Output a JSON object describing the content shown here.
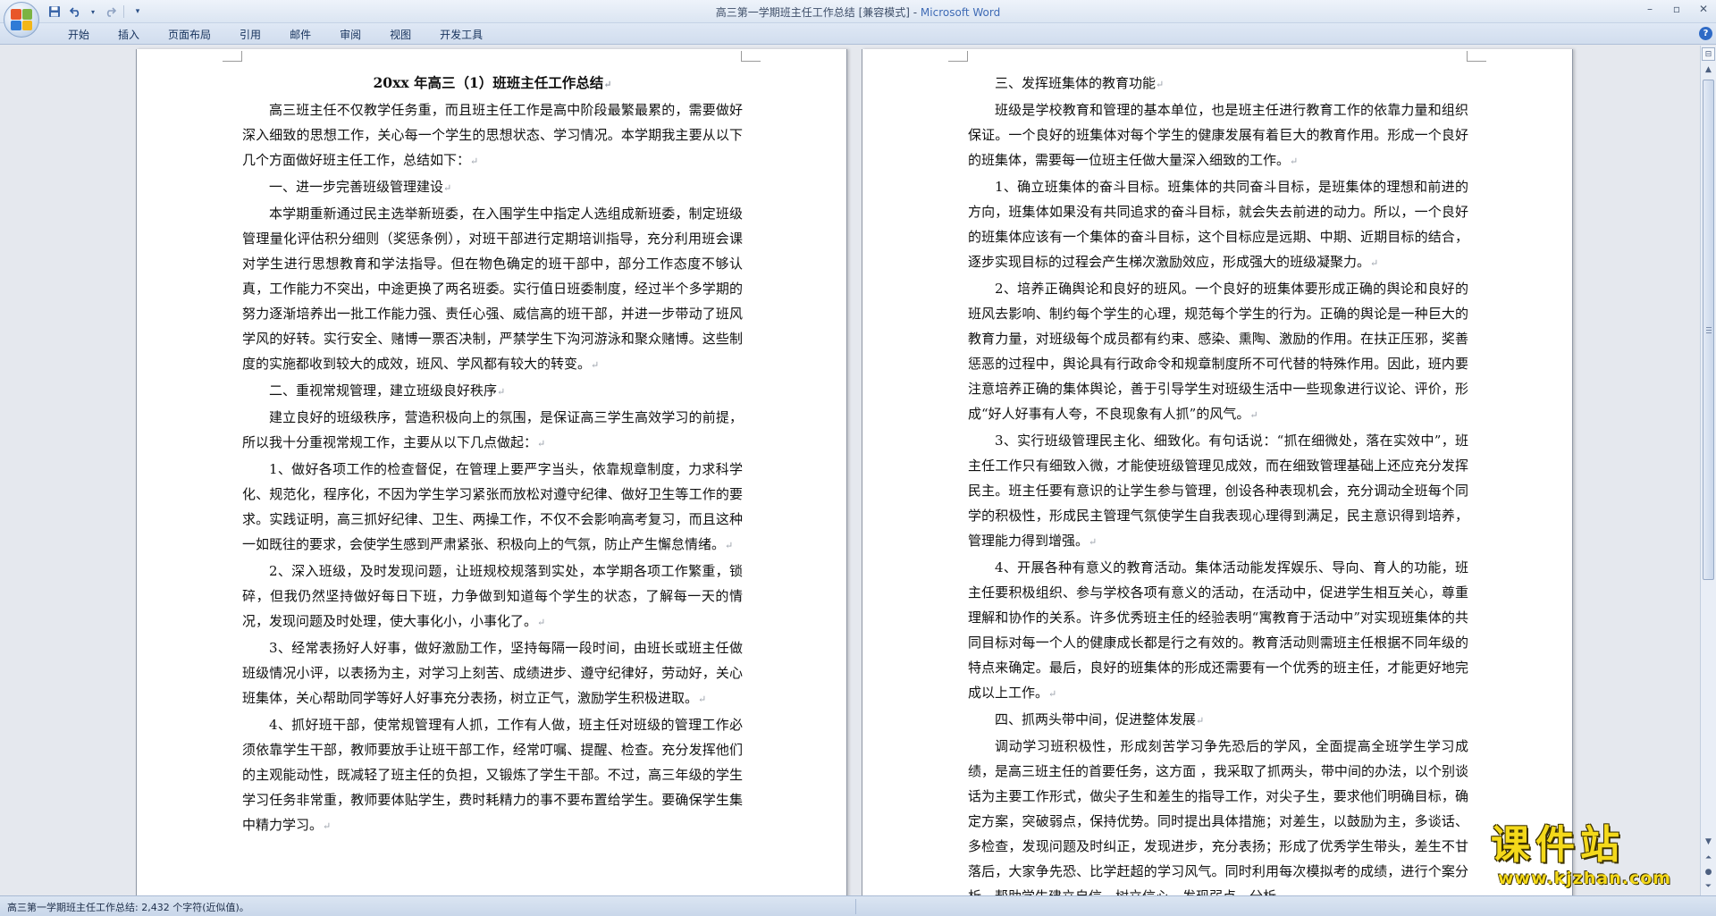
{
  "window": {
    "title": "高三第一学期班主任工作总结 [兼容模式] - ",
    "app_name": "Microsoft Word"
  },
  "quick_access": {
    "save_icon": "save-icon",
    "undo_icon": "undo-icon",
    "redo_icon": "redo-icon",
    "customize_icon": "dropdown-icon"
  },
  "ribbon": {
    "tabs": [
      "开始",
      "插入",
      "页面布局",
      "引用",
      "邮件",
      "审阅",
      "视图",
      "开发工具"
    ]
  },
  "document": {
    "title": "20xx 年高三（1）班班主任工作总结",
    "left_paragraphs": [
      "高三班主任不仅教学任务重，而且班主任工作是高中阶段最繁最累的，需要做好深入细致的思想工作，关心每一个学生的思想状态、学习情况。本学期我主要从以下几个方面做好班主任工作，总结如下：",
      "一、进一步完善班级管理建设",
      "本学期重新通过民主选举新班委，在入围学生中指定人选组成新班委，制定班级管理量化评估积分细则（奖惩条例），对班干部进行定期培训指导，充分利用班会课对学生进行思想教育和学法指导。但在物色确定的班干部中，部分工作态度不够认真，工作能力不突出，中途更换了两名班委。实行值日班委制度，经过半个多学期的努力逐渐培养出一批工作能力强、责任心强、威信高的班干部，并进一步带动了班风学风的好转。实行安全、赌博一票否决制，严禁学生下沟河游泳和聚众赌博。这些制度的实施都收到较大的成效，班风、学风都有较大的转变。",
      "二、重视常规管理，建立班级良好秩序",
      "建立良好的班级秩序，营造积极向上的氛围，是保证高三学生高效学习的前提，所以我十分重视常规工作，主要从以下几点做起：",
      "1、做好各项工作的检查督促，在管理上要严字当头，依靠规章制度，力求科学化、规范化，程序化，不因为学生学习紧张而放松对遵守纪律、做好卫生等工作的要求。实践证明，高三抓好纪律、卫生、两操工作，不仅不会影响高考复习，而且这种一如既往的要求，会使学生感到严肃紧张、积极向上的气氛，防止产生懈怠情绪。",
      "2、深入班级，及时发现问题，让班规校规落到实处，本学期各项工作繁重，锁碎，但我仍然坚持做好每日下班，力争做到知道每个学生的状态，了解每一天的情况，发现问题及时处理，使大事化小，小事化了。",
      "3、经常表扬好人好事，做好激励工作，坚持每隔一段时间，由班长或班主任做班级情况小评，以表扬为主，对学习上刻苦、成绩进步、遵守纪律好，劳动好，关心班集体，关心帮助同学等好人好事充分表扬，树立正气，激励学生积极进取。",
      "4、抓好班干部，使常规管理有人抓，工作有人做，班主任对班级的管理工作必须依靠学生干部，教师要放手让班干部工作，经常叮嘱、提醒、检查。充分发挥他们的主观能动性，既减轻了班主任的负担，又锻炼了学生干部。不过，高三年级的学生学习任务非常重，教师要体贴学生，费时耗精力的事不要布置给学生。要确保学生集中精力学习。"
    ],
    "right_paragraphs": [
      "三、发挥班集体的教育功能",
      "班级是学校教育和管理的基本单位，也是班主任进行教育工作的依靠力量和组织保证。一个良好的班集体对每个学生的健康发展有着巨大的教育作用。形成一个良好的班集体，需要每一位班主任做大量深入细致的工作。",
      "1、确立班集体的奋斗目标。班集体的共同奋斗目标，是班集体的理想和前进的方向，班集体如果没有共同追求的奋斗目标，就会失去前进的动力。所以，一个良好的班集体应该有一个集体的奋斗目标，这个目标应是远期、中期、近期目标的结合，逐步实现目标的过程会产生梯次激励效应，形成强大的班级凝聚力。",
      "2、培养正确舆论和良好的班风。一个良好的班集体要形成正确的舆论和良好的班风去影响、制约每个学生的心理，规范每个学生的行为。正确的舆论是一种巨大的教育力量，对班级每个成员都有约束、感染、熏陶、激励的作用。在扶正压邪，奖善惩恶的过程中，舆论具有行政命令和规章制度所不可代替的特殊作用。因此，班内要注意培养正确的集体舆论，善于引导学生对班级生活中一些现象进行议论、评价，形成“好人好事有人夸，不良现象有人抓”的风气。",
      "3、实行班级管理民主化、细致化。有句话说：“抓在细微处，落在实效中”，班主任工作只有细致入微，才能使班级管理见成效，而在细致管理基础上还应充分发挥民主。班主任要有意识的让学生参与管理，创设各种表现机会，充分调动全班每个同学的积极性，形成民主管理气氛使学生自我表现心理得到满足，民主意识得到培养，管理能力得到增强。",
      "4、开展各种有意义的教育活动。集体活动能发挥娱乐、导向、育人的功能，班主任要积极组织、参与学校各项有意义的活动，在活动中，促进学生相互关心，尊重理解和协作的关系。许多优秀班主任的经验表明“寓教育于活动中”对实现班集体的共同目标对每一个人的健康成长都是行之有效的。教育活动则需班主任根据不同年级的特点来确定。最后，良好的班集体的形成还需要有一个优秀的班主任，才能更好地完成以上工作。",
      "四、抓两头带中间，促进整体发展",
      "调动学习班积极性，形成刻苦学习争先恐后的学风，全面提高全班学生学习成绩，是高三班主任的首要任务，这方面 ，我采取了抓两头，带中间的办法，以个别谈话为主要工作形式，做尖子生和差生的指导工作，对尖子生，要求他们明确目标，确定方案，突破弱点，保持优势。同时提出具体措施；对差生，以鼓励为主，多谈话、多检查，发现问题及时纠正，发现进步，充分表扬；形成了优秀学生带头，差生不甘落后，大家争先恐、比学赶超的学习风气。同时利用每次模拟考的成绩，进行个案分析，帮助学生建立自信，树立信心，发现弱点，分析"
    ]
  },
  "statusbar": {
    "text": "高三第一学期班主任工作总结: 2,432 个字符(近似值)。"
  },
  "watermark": {
    "main": "课件站",
    "url": "www.kjzhan.com"
  },
  "colors": {
    "accent": "#3f6bb5",
    "watermark": "#f4d91a"
  }
}
